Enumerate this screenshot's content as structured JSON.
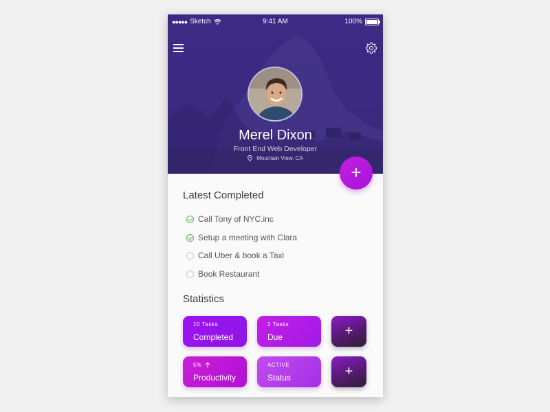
{
  "status_bar": {
    "carrier": "Sketch",
    "time": "9:41 AM",
    "battery": "100%"
  },
  "profile": {
    "name": "Merel Dixon",
    "title": "Front End Web Developer",
    "location": "Mountain View, CA"
  },
  "fab": {
    "label": "+"
  },
  "latest_completed": {
    "heading": "Latest Completed",
    "tasks": [
      {
        "label": "Call Tony of NYC.inc",
        "done": true
      },
      {
        "label": "Setup a meeting with Clara",
        "done": true
      },
      {
        "label": "Call Uber & book a Taxi",
        "done": false
      },
      {
        "label": "Book Restaurant",
        "done": false
      }
    ]
  },
  "statistics": {
    "heading": "Statistics",
    "tiles": [
      {
        "small": "10 Tasks",
        "big": "Completed"
      },
      {
        "small": "2 Tasks",
        "big": "Due"
      },
      {
        "small": "5%",
        "big": "Productivity"
      },
      {
        "small": "ACTIVE",
        "big": "Status"
      }
    ],
    "add_label": "+"
  },
  "colors": {
    "hero": "#3a2a80",
    "accent": "#c41fe0",
    "check_done": "#4cb64e"
  },
  "icons": [
    "hamburger-icon",
    "gear-icon",
    "location-pin-icon",
    "check-icon",
    "arrow-up-icon",
    "wifi-icon",
    "battery-icon"
  ]
}
